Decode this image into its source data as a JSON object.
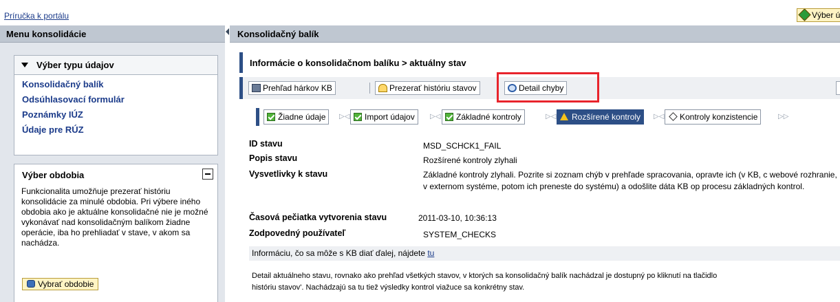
{
  "topbar": {
    "portal_link": "Príručka k portálu",
    "account_button": "Výber účt"
  },
  "left": {
    "header": "Menu konsolidácie",
    "data_type_box": {
      "title": "Výber typu údajov",
      "links": [
        "Konsolidačný balík",
        "Odsúhlasovací formulár",
        "Poznámky IÚZ",
        "Údaje pre RÚZ"
      ]
    },
    "period_box": {
      "title": "Výber obdobia",
      "description": "Funkcionalita umožňuje prezerať históriu konsolidácie za minulé obdobia. Pri výbere iného obdobia ako je aktuálne konsolidačné nie je možné vykonávať nad konsolidačným balíkom žiadne operácie, iba ho prehliadať v stave, v akom sa nachádza.",
      "button": "Vybrať obdobie"
    }
  },
  "main": {
    "header": "Konsolidačný balík",
    "subtitle": "Informácie o konsolidačnom balíku > aktuálny stav",
    "toolbar": {
      "sheets_button": "Prehľad hárkov KB",
      "history_button": "Prezerať históriu stavov",
      "detail_button": "Detail chyby"
    },
    "steps": [
      {
        "label": "Žiadne údaje",
        "state": "done"
      },
      {
        "label": "Import údajov",
        "state": "done"
      },
      {
        "label": "Základné kontroly",
        "state": "done"
      },
      {
        "label": "Rozšírené kontroly",
        "state": "warning"
      },
      {
        "label": "Kontroly konzistencie",
        "state": "pending"
      }
    ],
    "info": {
      "status_id_label": "ID stavu",
      "status_id": "MSD_SCHCK1_FAIL",
      "status_desc_label": "Popis stavu",
      "status_desc": "Rozšírené kontroly zlyhali",
      "explanation_label": "Vysvetlivky k stavu",
      "explanation": "Základné kontroly zlyhali. Pozrite si zoznam chýb v prehľade spracovania, opravte ich (v KB, c webové rozhranie, v externom systéme, potom ich preneste do systému) a odošlite dáta KB op procesu základných kontrol.",
      "timestamp_label": "Časová pečiatka vytvorenia stavu",
      "timestamp": "2011-03-10, 10:36:13",
      "user_label": "Zodpovedný používateľ",
      "user": "SYSTEM_CHECKS"
    },
    "next_info_text": "Informáciu, čo sa môže s KB diať ďalej, nájdete ",
    "next_info_link": "tu",
    "footer_line1": "Detail aktuálneho stavu, rovnako ako prehľad všetkých stavov, v ktorých sa konsolidačný balík nachádzal je dostupný po kliknutí na tlačidlo",
    "footer_line2": "históriu stavov'. Nachádzajú sa tu tiež výsledky kontrol viažuce sa konkrétny stav."
  }
}
